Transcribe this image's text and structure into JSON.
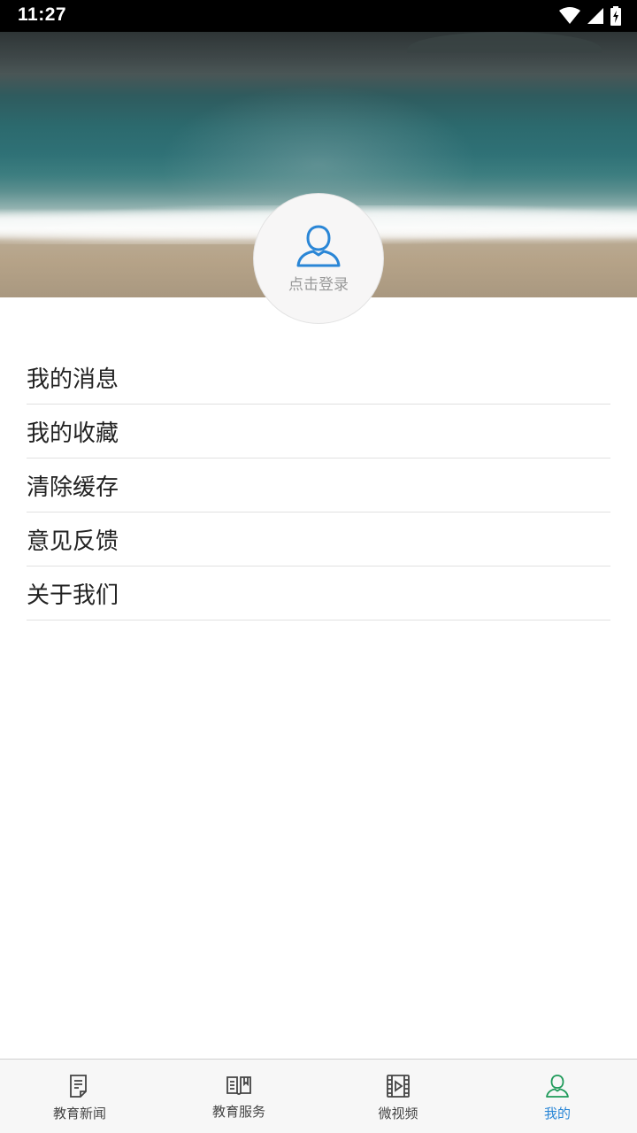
{
  "status_bar": {
    "time": "11:27"
  },
  "profile": {
    "login_label": "点击登录"
  },
  "menu": {
    "items": [
      {
        "label": "我的消息"
      },
      {
        "label": "我的收藏"
      },
      {
        "label": "清除缓存"
      },
      {
        "label": "意见反馈"
      },
      {
        "label": "关于我们"
      }
    ]
  },
  "bottom_nav": {
    "tabs": [
      {
        "label": "教育新闻",
        "icon": "news-icon"
      },
      {
        "label": "教育服务",
        "icon": "book-icon"
      },
      {
        "label": "微视频",
        "icon": "video-icon"
      },
      {
        "label": "我的",
        "icon": "user-icon",
        "active": true
      }
    ],
    "active_color": "#2a86d6"
  }
}
